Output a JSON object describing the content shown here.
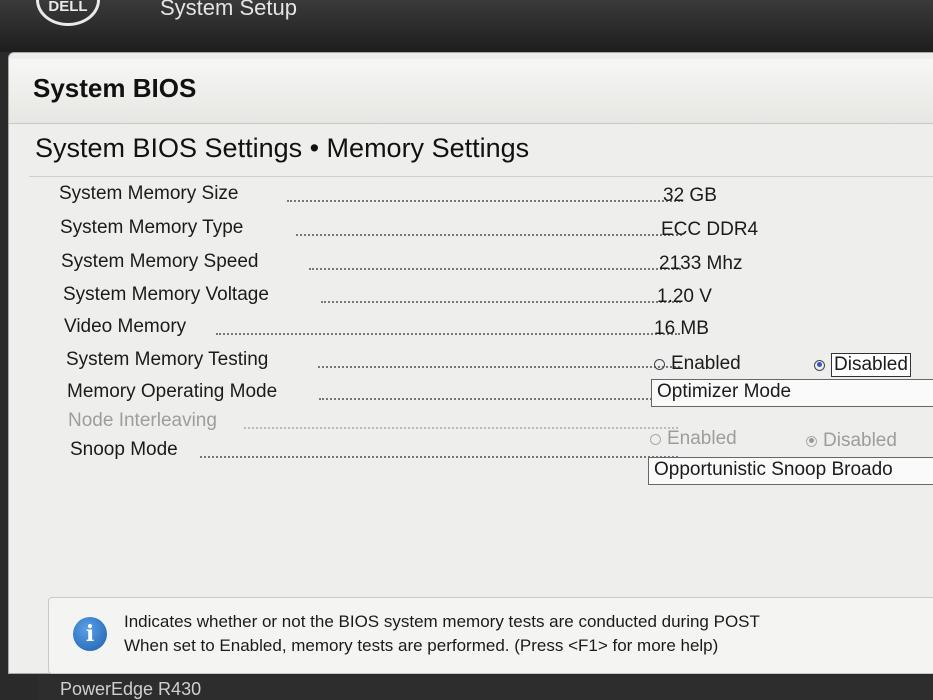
{
  "topbar": {
    "logo": "DELL",
    "app_title": "System Setup"
  },
  "header": {
    "title": "System BIOS",
    "subtitle": "System BIOS Settings • Memory Settings"
  },
  "settings": [
    {
      "label": "System Memory Size",
      "value": "32 GB"
    },
    {
      "label": "System Memory Type",
      "value": "ECC DDR4"
    },
    {
      "label": "System Memory Speed",
      "value": "2133 Mhz"
    },
    {
      "label": "System Memory Voltage",
      "value": "1.20 V"
    },
    {
      "label": "Video Memory",
      "value": "16 MB"
    },
    {
      "label": "System Memory Testing",
      "options": [
        "Enabled",
        "Disabled"
      ],
      "selected": "Disabled"
    },
    {
      "label": "Memory Operating Mode",
      "value": "Optimizer Mode"
    },
    {
      "label": "Node Interleaving",
      "options": [
        "Enabled",
        "Disabled"
      ],
      "selected": "Disabled",
      "disabled": true
    },
    {
      "label": "Snoop Mode",
      "value": "Opportunistic Snoop Broado"
    }
  ],
  "help": {
    "line1": "Indicates whether or not the BIOS system memory tests are conducted during POST",
    "line2": "When set to Enabled, memory tests are performed. (Press <F1> for more help)"
  },
  "footer": {
    "model": "PowerEdge R430"
  },
  "colors": {
    "accent": "#2b5cc0",
    "panel": "#eeeeec",
    "topbar": "#2a2a2a"
  },
  "icons": {
    "info": "info-icon"
  }
}
